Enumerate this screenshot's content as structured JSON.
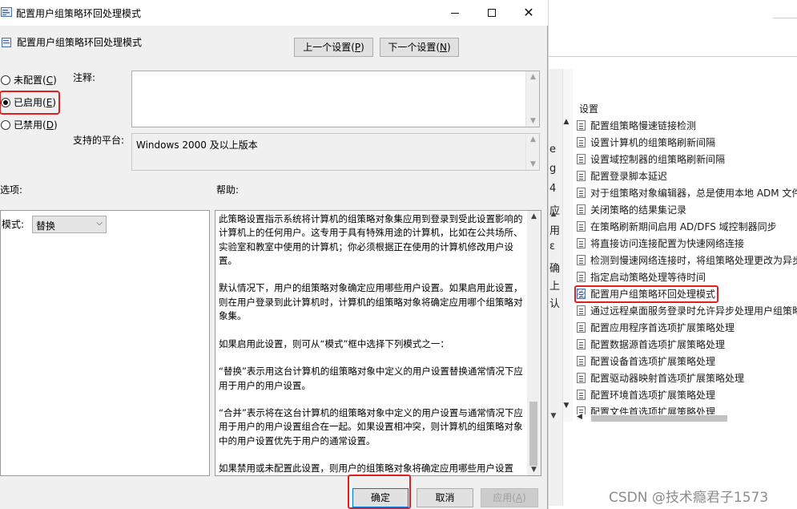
{
  "dialog": {
    "title": "配置用户组策略环回处理模式",
    "setting_title": "配置用户组策略环回处理模式",
    "prev_button": {
      "label": "上一个设置(",
      "key": "P",
      "suffix": ")"
    },
    "next_button": {
      "label": "下一个设置(",
      "key": "N",
      "suffix": ")"
    },
    "radios": [
      {
        "label": "未配置(",
        "key": "C",
        "suffix": ")",
        "checked": false
      },
      {
        "label": "已启用(",
        "key": "E",
        "suffix": ")",
        "checked": true
      },
      {
        "label": "已禁用(",
        "key": "D",
        "suffix": ")",
        "checked": false
      }
    ],
    "comment_label": "注释:",
    "comment_value": "",
    "platform_label": "支持的平台:",
    "platform_value": "Windows 2000 及以上版本",
    "options_label": "选项:",
    "help_label": "帮助:",
    "mode_label": "模式:",
    "mode_value": "替换",
    "help_paragraphs": [
      "此策略设置指示系统将计算机的组策略对象集应用到登录到受此设置影响的计算机上的任何用户。这专用于具有特殊用途的计算机，比如在公共场所、实验室和教室中使用的计算机；你必须根据正在使用的计算机修改用户设置。",
      "默认情况下，用户的组策略对象确定应用哪些用户设置。如果启用此设置，则在用户登录到此计算机时，计算机的组策略对象将确定应用哪个组策略对象集。",
      "如果启用此设置，则可从“模式”框中选择下列模式之一：",
      "“替换”表示用这台计算机的组策略对象中定义的用户设置替换通常情况下应用于用户的用户设置。",
      "“合并”表示将在这台计算机的组策略对象中定义的用户设置与通常情况下应用于用户的用户设置组合在一起。如果设置相冲突，则计算机的组策略对象中的用户设置优先于用户的通常设置。",
      "如果禁用或未配置此设置，则用户的组策略对象将确定应用哪些用户设置"
    ],
    "ok_label": "确定",
    "cancel_label": "取消",
    "apply_label": {
      "label": "应用(",
      "key": "A",
      "suffix": ")"
    }
  },
  "background": {
    "settings_header": "设置",
    "left_fragments": [
      "e",
      "g",
      "4",
      "应",
      "用",
      "ε",
      "确",
      "上",
      "认"
    ],
    "policies": [
      "配置组策略慢速链接检测",
      "设置计算机的组策略刷新间隔",
      "设置域控制器的组策略刷新间隔",
      "配置登录脚本延迟",
      "对于组策略对象编辑器，总是使用本地 ADM 文件",
      "关闭策略的结果集记录",
      "在策略刷新期间启用 AD/DFS 域控制器同步",
      "将直接访问连接配置为快速网络连接",
      "检测到慢速网络连接时，将组策略处理更改为异步",
      "指定启动策略处理等待时间",
      "配置用户组策略环回处理模式",
      "通过远程桌面服务登录时允许异步处理用户组策略",
      "配置应用程序首选项扩展策略处理",
      "配置数据源首选项扩展策略处理",
      "配置设备首选项扩展策略处理",
      "配置驱动器映射首选项扩展策略处理",
      "配置环境首选项扩展策略处理"
    ],
    "partial_item": "配置文件首选项扩展策略处理",
    "selected_index": 10
  },
  "watermark": "CSDN @技术瘾君子1573",
  "colors": {
    "highlight_red": "#e02020",
    "accent_blue": "#0078d7"
  }
}
